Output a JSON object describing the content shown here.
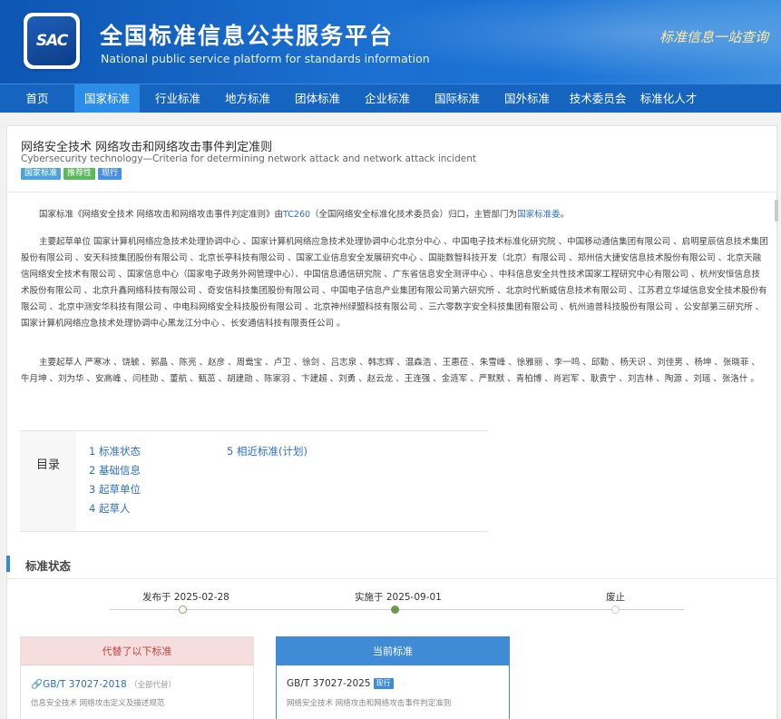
{
  "header": {
    "logo_text": "SAC",
    "title_cn": "全国标准信息公共服务平台",
    "title_en": "National public service platform  for standards information",
    "slogan": "标准信息一站查询"
  },
  "nav": {
    "items": [
      {
        "label": "首页"
      },
      {
        "label": "国家标准"
      },
      {
        "label": "行业标准"
      },
      {
        "label": "地方标准"
      },
      {
        "label": "团体标准"
      },
      {
        "label": "企业标准"
      },
      {
        "label": "国际标准"
      },
      {
        "label": "国外标准"
      },
      {
        "label": "技术委员会"
      },
      {
        "label": "标准化人才"
      }
    ],
    "active": "国家标准"
  },
  "standard": {
    "title_cn": "网络安全技术 网络攻击和网络攻击事件判定准则",
    "title_en": "Cybersecurity technology—Criteria for determining network attack and network attack incident",
    "badges": [
      "国家标准",
      "推荐性",
      "现行"
    ]
  },
  "intro": {
    "p1_a": "国家标准《网络安全技术 网络攻击和网络攻击事件判定准则》由",
    "p1_tc": "TC260",
    "p1_b": "（全国网络安全标准化技术委员会）归口，主管部门为",
    "p1_dept": "国家标准委",
    "p1_c": "。",
    "p2": "主要起草单位 国家计算机网络应急技术处理协调中心 、国家计算机网络应急技术处理协调中心北京分中心 、中国电子技术标准化研究院 、中国移动通信集团有限公司 、启明星辰信息技术集团股份有限公司 、安天科技集团股份有限公司 、北京长亭科技有限公司 、国家工业信息安全发展研究中心 、国能数智科技开发（北京）有限公司 、郑州信大捷安信息技术股份有限公司 、北京天融信网络安全技术有限公司 、国家信息中心（国家电子政务外网管理中心）、中国信息通信研究院 、广东省信息安全测评中心 、中科信息安全共性技术国家工程研究中心有限公司 、杭州安恒信息技术股份有限公司 、北京升鑫网络科技有限公司 、奇安信科技集团股份有限公司 、中国电子信息产业集团有限公司第六研究所 、北京时代新威信息技术有限公司 、江苏君立华域信息安全技术股份有限公司 、北京中测安华科技有限公司 、中电科网络安全科技股份有限公司 、北京神州绿盟科技有限公司 、三六零数字安全科技集团有限公司 、杭州迪普科技股份有限公司 、公安部第三研究所 、国家计算机网络应急技术处理协调中心黑龙江分中心 、长安通信科技有限责任公司 。",
    "p3": "主要起草人 严寒冰 、饶毓 、郭晶 、陈亮 、赵彦 、周鸯宝 、卢卫 、徐剑 、吕志泉 、韩志辉 、温森浩 、王惠莅 、朱雪峰 、徐雅丽 、李一鸣 、邱勤 、杨天识 、刘佳男 、杨坤 、张晓菲 、牛月坤 、刘为华 、安高峰 、闫桂勋 、董航 、甄茁 、胡建勋 、陈家羽 、卞建超 、刘勇 、赵云龙 、王连强 、金涟军 、严默默 、青柏博 、肖岩军 、耿贵宁 、刘吉林 、陶源 、刘瑶 、张洛什 。"
  },
  "toc": {
    "label": "目录",
    "items": [
      "1  标准状态",
      "2  基础信息",
      "3  起草单位",
      "4  起草人",
      "5  相近标准(计划)"
    ]
  },
  "status_section": {
    "title": "标准状态",
    "timeline": [
      {
        "label": "发布于 2025-02-28",
        "state": "done"
      },
      {
        "label": "实施于 2025-09-01",
        "state": "current"
      },
      {
        "label": "废止",
        "state": "pending"
      }
    ]
  },
  "cards": {
    "replaced": {
      "header": "代替了以下标准",
      "code": "GB/T 37027-2018",
      "note": "（全部代替）",
      "name": "信息安全技术 网络攻击定义及描述规范"
    },
    "current": {
      "header": "当前标准",
      "code": "GB/T 37027-2025",
      "status": "现行",
      "name": "网络安全技术 网络攻击和网络攻击事件判定准则"
    }
  },
  "colors": {
    "nav_bg": "#1565c0",
    "nav_active": "#2c8de8",
    "link": "#2d6fc4",
    "accent": "#2d8ce8"
  }
}
